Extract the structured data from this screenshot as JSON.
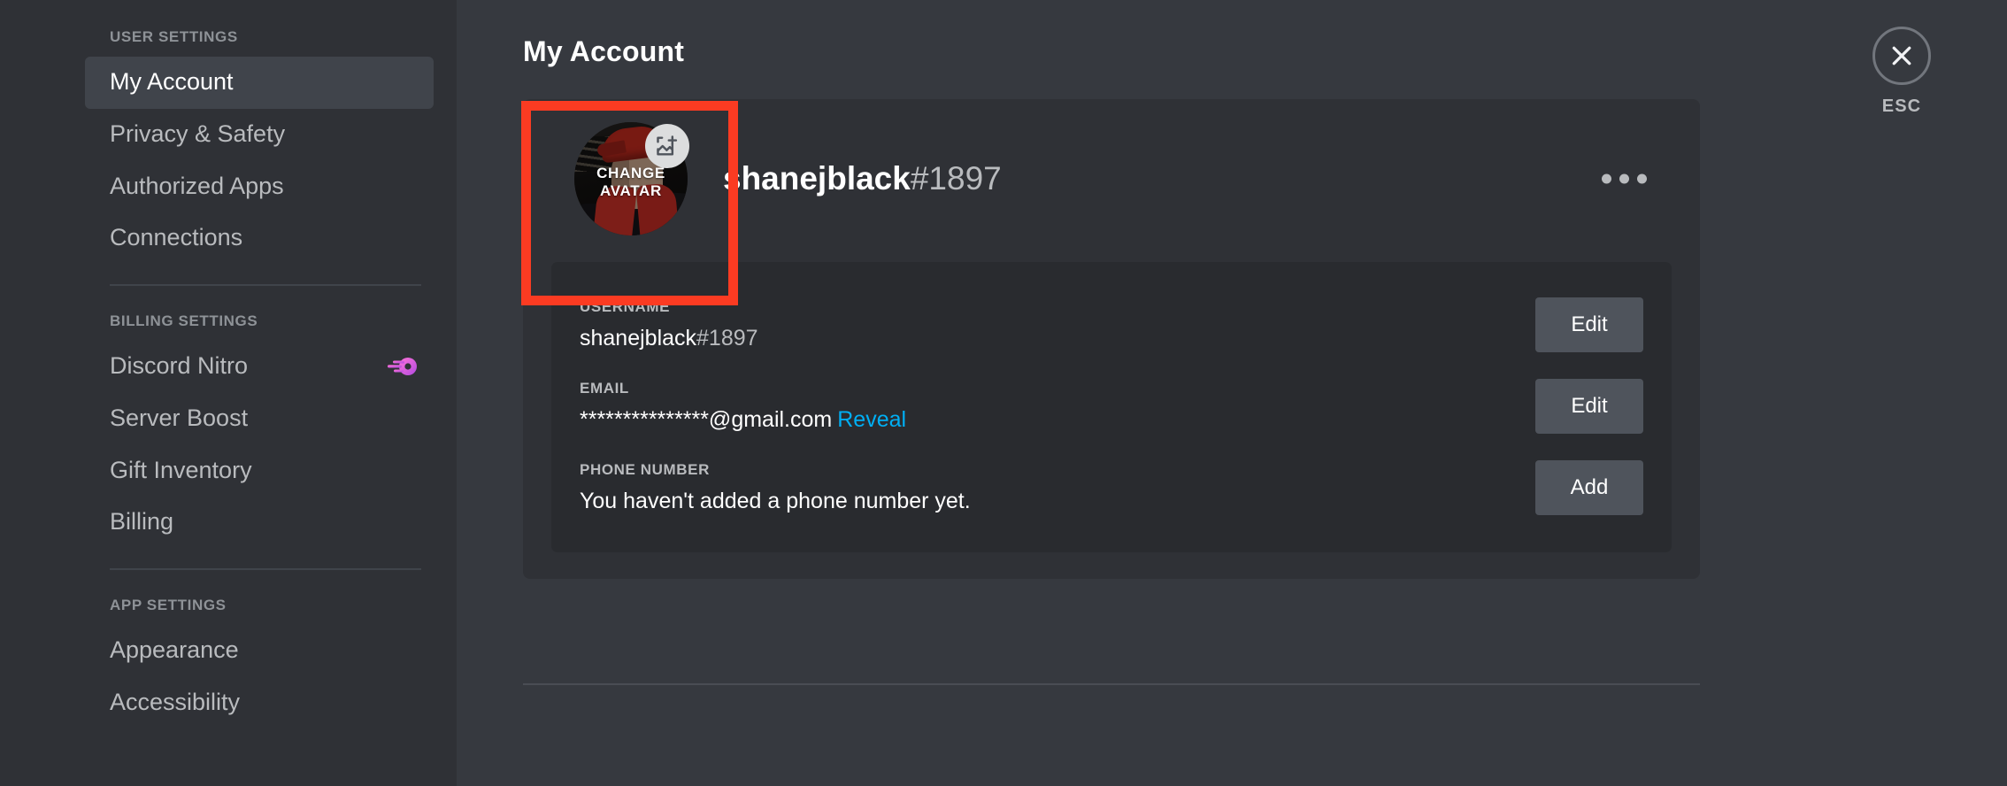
{
  "sidebar": {
    "sections": [
      {
        "header": "USER SETTINGS",
        "items": [
          {
            "label": "My Account",
            "active": true,
            "icon": null
          },
          {
            "label": "Privacy & Safety",
            "active": false,
            "icon": null
          },
          {
            "label": "Authorized Apps",
            "active": false,
            "icon": null
          },
          {
            "label": "Connections",
            "active": false,
            "icon": null
          }
        ]
      },
      {
        "header": "BILLING SETTINGS",
        "items": [
          {
            "label": "Discord Nitro",
            "active": false,
            "icon": "nitro-boost-icon"
          },
          {
            "label": "Server Boost",
            "active": false,
            "icon": null
          },
          {
            "label": "Gift Inventory",
            "active": false,
            "icon": null
          },
          {
            "label": "Billing",
            "active": false,
            "icon": null
          }
        ]
      },
      {
        "header": "APP SETTINGS",
        "items": [
          {
            "label": "Appearance",
            "active": false,
            "icon": null
          },
          {
            "label": "Accessibility",
            "active": false,
            "icon": null
          }
        ]
      }
    ]
  },
  "header": {
    "title": "My Account",
    "close": {
      "icon": "close-x-icon",
      "label": "ESC"
    }
  },
  "profile": {
    "avatar": {
      "overlay_line1": "CHANGE",
      "overlay_line2": "AVATAR",
      "badge_icon": "add-image-icon",
      "alt": "User avatar photo: person wearing a red backwards cap and red hoodie"
    },
    "username": "shanejblack",
    "discriminator": "#1897",
    "more_icon": "more-options-icon"
  },
  "fields": [
    {
      "label": "USERNAME",
      "value": "shanejblack",
      "value_suffix": "#1897",
      "link": null,
      "button": "Edit"
    },
    {
      "label": "EMAIL",
      "value": "***************@gmail.com",
      "value_suffix": "",
      "link": "Reveal",
      "button": "Edit"
    },
    {
      "label": "PHONE NUMBER",
      "value": "You haven't added a phone number yet.",
      "value_suffix": "",
      "link": null,
      "button": "Add"
    }
  ],
  "annotation": {
    "type": "highlight-box",
    "color": "#fb3b22",
    "target": "change-avatar-control"
  },
  "colors": {
    "sidebar_bg": "#2f3136",
    "content_bg": "#36393f",
    "card_bg": "#2f3136",
    "panel_bg": "#292b2f",
    "active_item_bg": "#40444b",
    "button_bg": "#4f545c",
    "link_blue": "#00aff4",
    "muted_text": "#b9bbbe",
    "header_text": "#8e9297",
    "annotation_red": "#fb3b22"
  }
}
